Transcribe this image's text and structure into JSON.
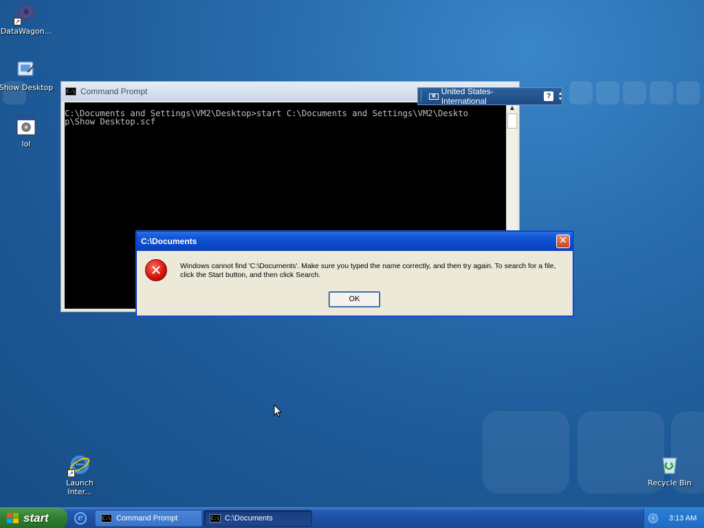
{
  "desktop": {
    "icons": [
      {
        "label": "DataWagon...",
        "icon": "datawagon-icon"
      },
      {
        "label": "Show Desktop",
        "icon": "show-desktop-icon"
      },
      {
        "label": "lol",
        "icon": "program-icon"
      },
      {
        "label": "Launch Inter...",
        "icon": "internet-explorer-icon"
      },
      {
        "label": "Recycle Bin",
        "icon": "recycle-bin-icon"
      }
    ]
  },
  "cmd": {
    "title": "Command Prompt",
    "title_icon": "C:\\",
    "lines": [
      "C:\\Documents and Settings\\VM2\\Desktop>start C:\\Documents and Settings\\VM2\\Deskto",
      "p\\Show Desktop.scf"
    ]
  },
  "langbar": {
    "language": "United States-International",
    "help": "?"
  },
  "dialog": {
    "title": "C:\\Documents",
    "message": "Windows cannot find 'C:\\Documents'. Make sure you typed the name correctly, and then try again. To search for a file, click the Start button, and then click Search.",
    "ok_label": "OK",
    "icon": "error-icon"
  },
  "taskbar": {
    "start_label": "start",
    "buttons": [
      {
        "label": "Command Prompt",
        "active": false
      },
      {
        "label": "C:\\Documents",
        "active": true
      }
    ],
    "clock": "3:13 AM"
  },
  "colors": {
    "desktop": "#1e5b99",
    "dialog_title": "#0a49c9",
    "taskbar": "#245ab4",
    "start_button": "#2f7d2f"
  }
}
